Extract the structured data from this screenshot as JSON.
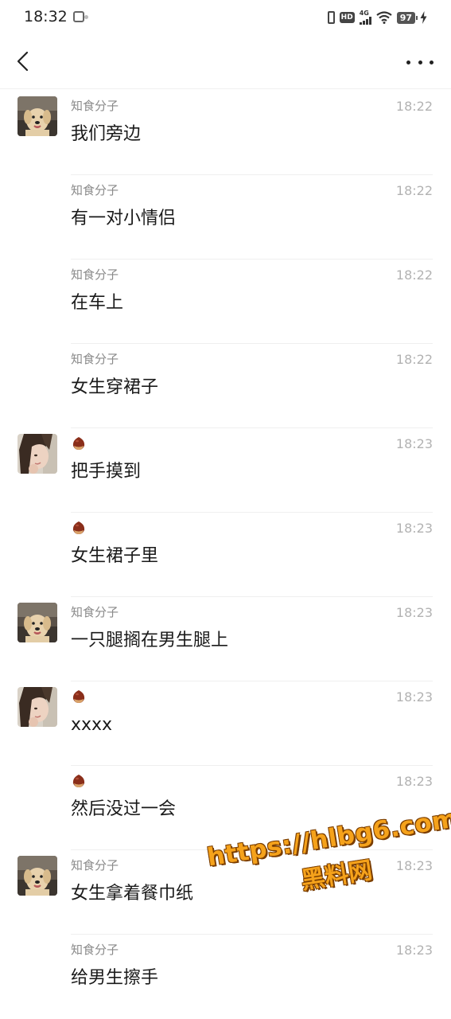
{
  "status_bar": {
    "time": "18:32",
    "network_label": "4G",
    "hd_label": "HD",
    "battery": "97"
  },
  "nav": {
    "back_icon": "chevron-left-icon",
    "more_icon": "more-dots-icon"
  },
  "messages": [
    {
      "sender": "知食分子",
      "avatar": "dog",
      "time": "18:22",
      "text": "我们旁边"
    },
    {
      "sender": "知食分子",
      "avatar": "",
      "time": "18:22",
      "text": "有一对小情侣"
    },
    {
      "sender": "知食分子",
      "avatar": "",
      "time": "18:22",
      "text": "在车上"
    },
    {
      "sender": "知食分子",
      "avatar": "",
      "time": "18:22",
      "text": "女生穿裙子"
    },
    {
      "sender": "",
      "sender_icon": "chestnut-emoji",
      "avatar": "girl",
      "time": "18:23",
      "text": "把手摸到"
    },
    {
      "sender": "",
      "sender_icon": "chestnut-emoji",
      "avatar": "",
      "time": "18:23",
      "text": "女生裙子里"
    },
    {
      "sender": "知食分子",
      "avatar": "dog",
      "time": "18:23",
      "text": "一只腿搁在男生腿上"
    },
    {
      "sender": "",
      "sender_icon": "chestnut-emoji",
      "avatar": "girl",
      "time": "18:23",
      "text": "xxxx"
    },
    {
      "sender": "",
      "sender_icon": "chestnut-emoji",
      "avatar": "",
      "time": "18:23",
      "text": "然后没过一会"
    },
    {
      "sender": "知食分子",
      "avatar": "dog",
      "time": "18:23",
      "text": "女生拿着餐巾纸"
    },
    {
      "sender": "知食分子",
      "avatar": "",
      "time": "18:23",
      "text": "给男生擦手"
    }
  ],
  "watermark": {
    "url": "https://hlbg6.com",
    "label": "黑料网"
  }
}
